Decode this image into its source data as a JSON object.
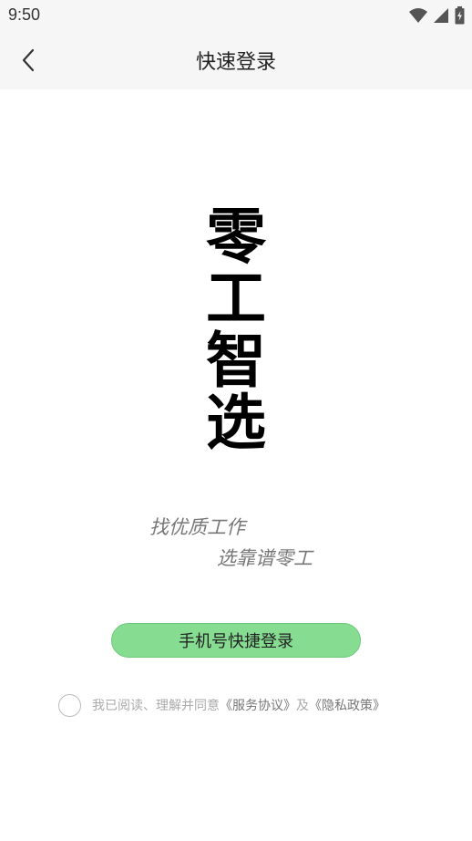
{
  "status_bar": {
    "time": "9:50"
  },
  "header": {
    "title": "快速登录"
  },
  "logo": {
    "chars": [
      "零",
      "工",
      "智",
      "选"
    ]
  },
  "slogan": {
    "line1": "找优质工作",
    "line2": "选靠谱零工"
  },
  "login_button": {
    "label": "手机号快捷登录"
  },
  "agreement": {
    "prefix": "我已阅读、理解并同意",
    "service_link": "《服务协议》",
    "joiner": "及",
    "privacy_link": "《隐私政策》"
  },
  "colors": {
    "primary": "#86dd92",
    "bar": "#f6f6f6"
  }
}
